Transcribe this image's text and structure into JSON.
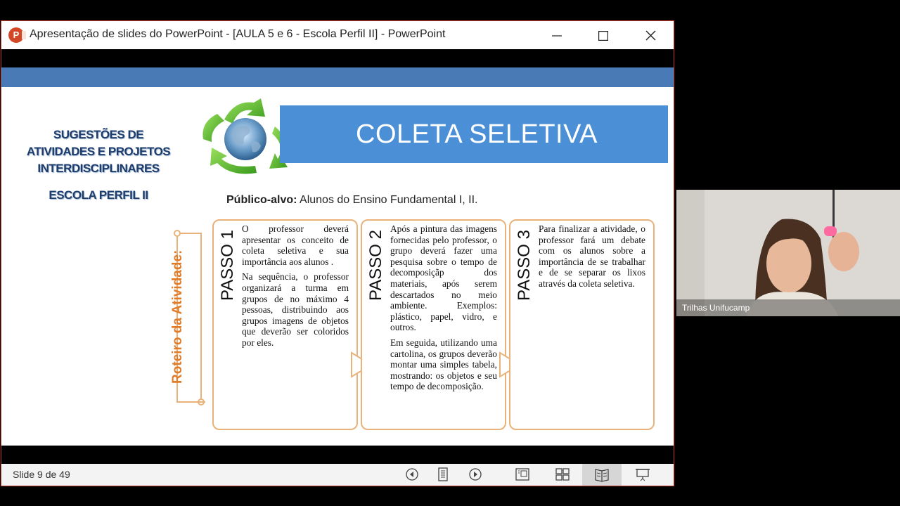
{
  "window": {
    "title": "Apresentação de slides do PowerPoint - [AULA 5 e 6 - Escola Perfil II] - PowerPoint",
    "app_icon_letter": "P",
    "minimize_symbol": "—",
    "maximize_symbol": "☐",
    "close_symbol": "✕"
  },
  "slide": {
    "side_title_lines": [
      "SUGESTÕES DE",
      "ATIVIDADES E PROJETOS",
      "INTERDISCIPLINARES"
    ],
    "school": "ESCOLA PERFIL II",
    "banner_title": "COLETA SELETIVA",
    "audience_label": "Público-alvo:",
    "audience_value": " Alunos do Ensino Fundamental I, II.",
    "roteiro_label": "Roteiro da Atividade:",
    "steps": [
      {
        "label": "PASSO 1",
        "paragraphs": [
          "O professor deverá apresentar os conceito de coleta seletiva e sua importância aos alunos .",
          "Na sequência, o professor organizará a turma em grupos de no máximo 4 pessoas, distribuindo aos grupos imagens de objetos que deverão ser coloridos por eles."
        ]
      },
      {
        "label": "PASSO 2",
        "paragraphs": [
          "Após a pintura das imagens fornecidas pelo professor, o grupo deverá fazer uma pesquisa sobre o tempo de decomposiçãp dos materiais, após serem descartados no meio ambiente. Exemplos: plástico, papel, vidro, e outros.",
          "Em seguida, utilizando uma cartolina, os grupos deverão montar uma simples tabela, mostrando: os objetos e seu tempo de decomposição."
        ]
      },
      {
        "label": "PASSO 3",
        "paragraphs": [
          "Para finalizar a atividade, o professor fará um debate com os alunos sobre a importância de se trabalhar e de se separar os lixos através da coleta seletiva."
        ]
      }
    ],
    "colors": {
      "topbar": "#4a7ab5",
      "banner": "#4b8fd6",
      "accent_orange": "#e07b28",
      "box_border": "#e9b27a"
    }
  },
  "statusbar": {
    "slide_counter": "Slide 9 de 49",
    "icons": [
      "previous-icon",
      "menu-icon",
      "next-icon",
      "normal-view-icon",
      "slide-sorter-icon",
      "reading-view-icon",
      "slideshow-icon"
    ]
  },
  "video": {
    "participant_name": "Trilhas Unifucamp"
  }
}
